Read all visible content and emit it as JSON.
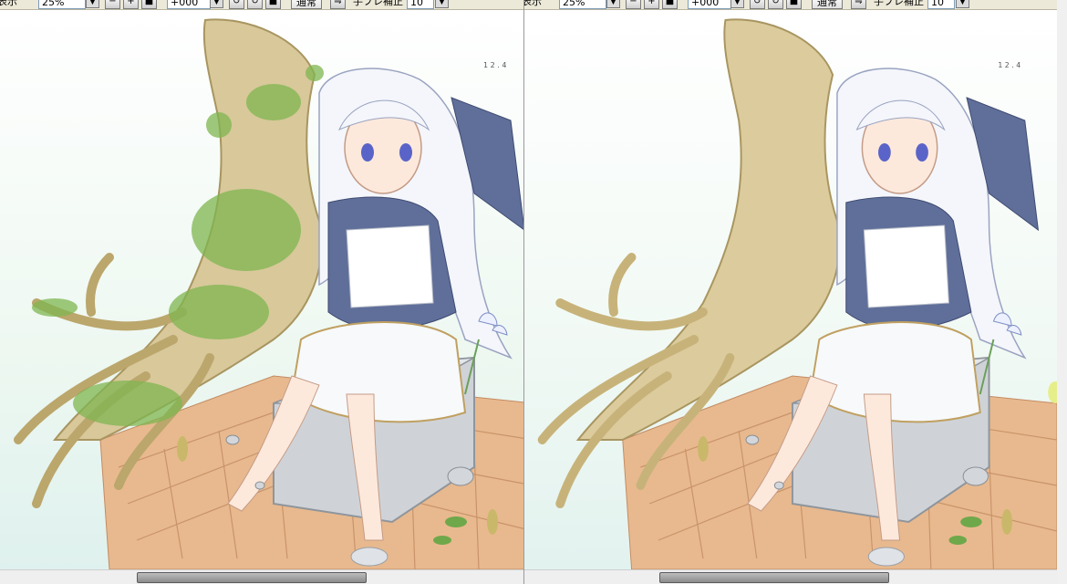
{
  "toolbar": {
    "view_label": "表示",
    "zoom_value": "25%",
    "rotation_value": "+000",
    "blend_mode": "通常",
    "stabilizer_label": "手ブレ補正",
    "stabilizer_value": "10"
  },
  "toolbar_right": {
    "view_label": "表示",
    "zoom_value": "25%",
    "rotation_value": "+000",
    "blend_mode": "通常",
    "stabilizer_label": "手ブレ補正",
    "stabilizer_value": "10"
  },
  "canvas": {
    "signature_left": "1 2 . 4",
    "signature_right": "1 2 . 4"
  },
  "colors": {
    "toolbar_bg": "#ece9d8",
    "trunk": "#d9c99a",
    "moss": "#7fb650",
    "brick": "#e7b78c",
    "stone": "#c9cdd2",
    "ribbon": "#5f6f9a"
  },
  "icons": {
    "zoom_out": "minus-icon",
    "zoom_in": "plus-icon",
    "rotate_ccw": "rotate-left-icon",
    "rotate_cw": "rotate-right-icon",
    "flip": "flip-icon"
  }
}
